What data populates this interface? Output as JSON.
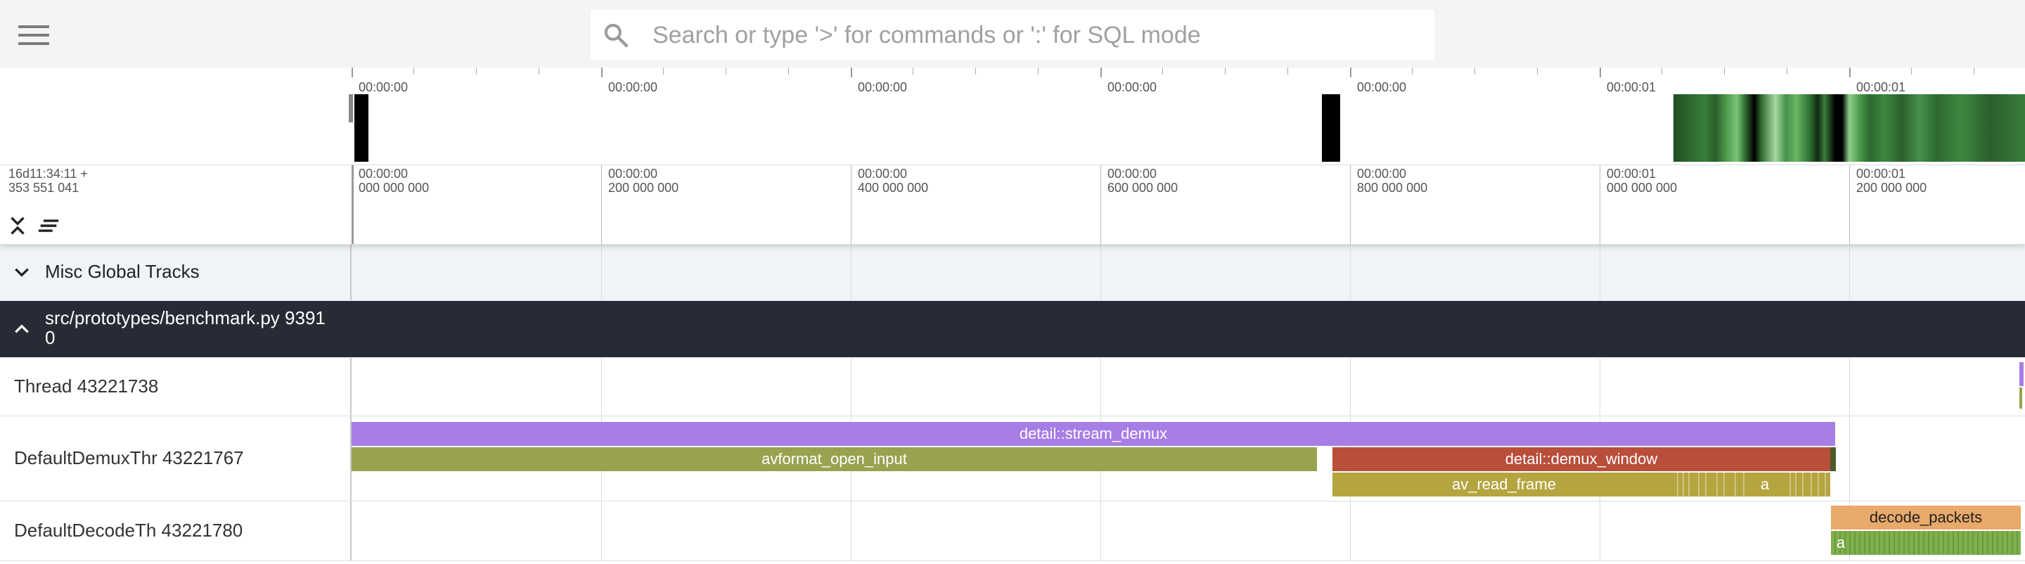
{
  "search": {
    "placeholder": "Search or type '>' for commands or ':' for SQL mode"
  },
  "overview": {
    "tick_labels": [
      "00:00:00",
      "00:00:00",
      "00:00:00",
      "00:00:00",
      "00:00:00",
      "00:00:01",
      "00:00:01"
    ]
  },
  "timeaxis": {
    "offset_line1": "16d11:34:11 +",
    "offset_line2": "353 551 041",
    "ticks": [
      {
        "time": "00:00:00",
        "ns": "000 000 000"
      },
      {
        "time": "00:00:00",
        "ns": "200 000 000"
      },
      {
        "time": "00:00:00",
        "ns": "400 000 000"
      },
      {
        "time": "00:00:00",
        "ns": "600 000 000"
      },
      {
        "time": "00:00:00",
        "ns": "800 000 000"
      },
      {
        "time": "00:00:01",
        "ns": "000 000 000"
      },
      {
        "time": "00:00:01",
        "ns": "200 000 000"
      }
    ]
  },
  "tracks": {
    "misc_title": "Misc Global Tracks",
    "process_title_line1": "src/prototypes/benchmark.py 9391",
    "process_title_line2": "0",
    "thread1": "Thread 43221738",
    "thread2": "DefaultDemuxThr 43221767",
    "thread3": "DefaultDecodeTh 43221780"
  },
  "slices": {
    "stream_demux": "detail::stream_demux",
    "avformat_open_input": "avformat_open_input",
    "demux_window": "detail::demux_window",
    "av_read_frame": "av_read_frame",
    "a_small": "a",
    "decode_packets": "decode_packets",
    "a_decode": "a"
  },
  "colors": {
    "stream_demux": "#a77de6",
    "avformat_open_input": "#98a24f",
    "demux_window": "#b94e3b",
    "av_read_frame": "#b5a53f",
    "decode_packets": "#e9a96a",
    "decode_child": "#7fb04c",
    "process_header": "#262b35"
  },
  "icons": {
    "menu": "hamburger-icon",
    "search": "search-icon",
    "collapse_all": "collapse-all-icon",
    "sort": "sort-lines-icon",
    "misc_chevron": "chevron-down-icon",
    "proc_chevron": "chevron-up-icon"
  }
}
